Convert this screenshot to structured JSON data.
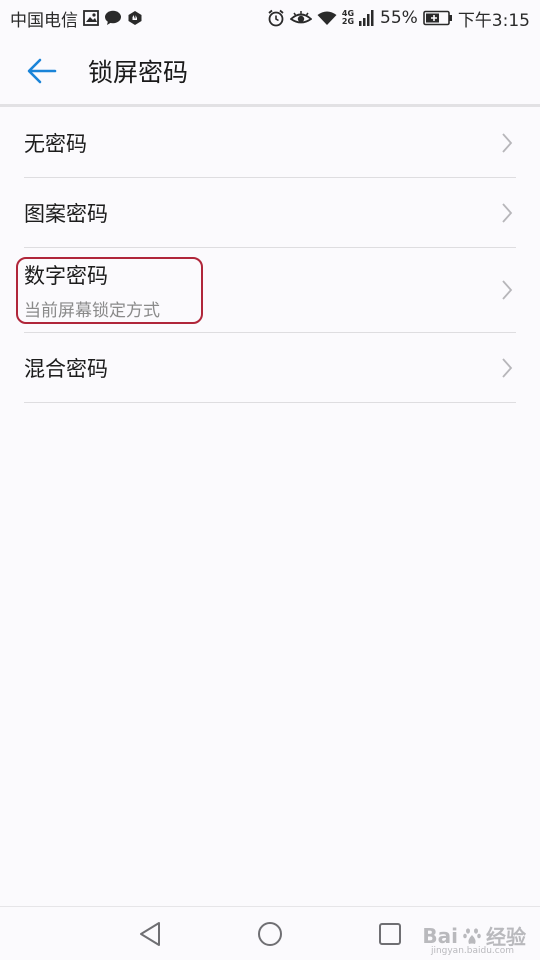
{
  "status_bar": {
    "carrier": "中国电信",
    "net_top": "4G",
    "net_bottom": "2G",
    "battery": "55%",
    "time": "下午3:15"
  },
  "header": {
    "title": "锁屏密码"
  },
  "options": [
    {
      "label": "无密码"
    },
    {
      "label": "图案密码"
    },
    {
      "label": "数字密码",
      "sublabel": "当前屏幕锁定方式"
    },
    {
      "label": "混合密码"
    }
  ],
  "watermark": {
    "brand": "Bai",
    "brand_cn": "经验",
    "site": "jingyan.baidu.com"
  },
  "colors": {
    "accent": "#1a84d8",
    "highlight": "#b0263a",
    "background": "#fbfafd"
  }
}
